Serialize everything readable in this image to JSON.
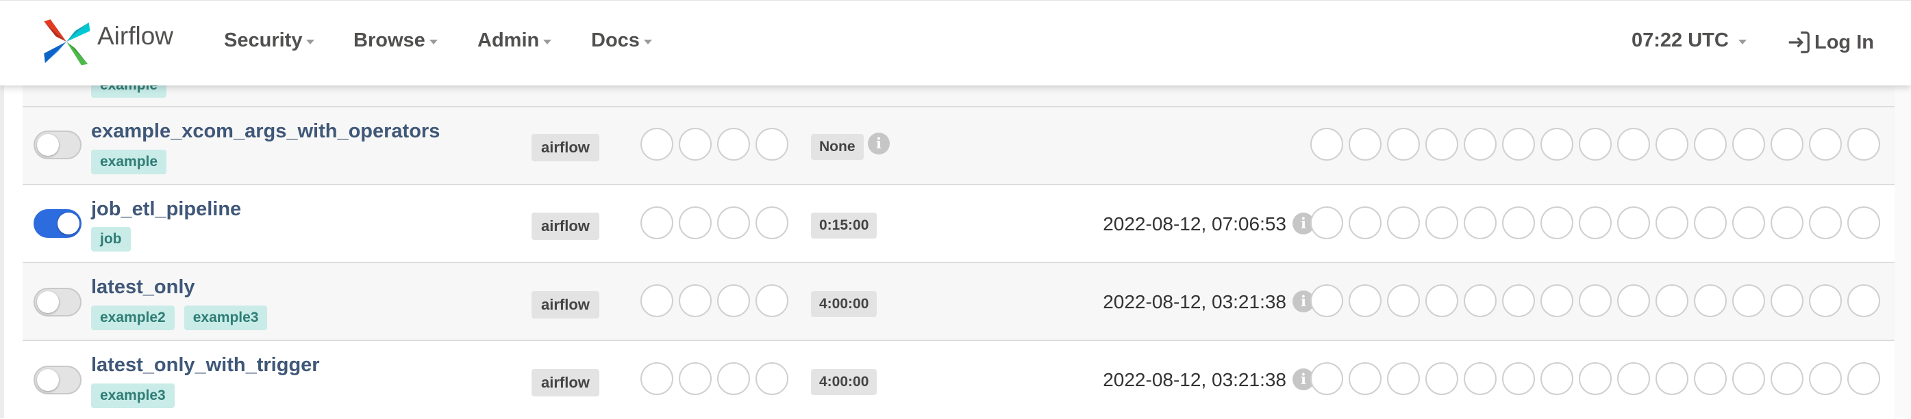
{
  "navbar": {
    "brand": "Airflow",
    "items": [
      {
        "label": "Security"
      },
      {
        "label": "Browse"
      },
      {
        "label": "Admin"
      },
      {
        "label": "Docs"
      }
    ],
    "time": "07:22 UTC",
    "login": "Log In"
  },
  "partial_row": {
    "tag": "example"
  },
  "rows": [
    {
      "name": "example_xcom_args_with_operators",
      "tags": [
        "example"
      ],
      "owner": "airflow",
      "schedule": "None",
      "next_run": "",
      "paused": true
    },
    {
      "name": "job_etl_pipeline",
      "tags": [
        "job"
      ],
      "owner": "airflow",
      "schedule": "0:15:00",
      "next_run": "2022-08-12, 07:06:53",
      "paused": false
    },
    {
      "name": "latest_only",
      "tags": [
        "example2",
        "example3"
      ],
      "owner": "airflow",
      "schedule": "4:00:00",
      "next_run": "2022-08-12, 03:21:38",
      "paused": true
    },
    {
      "name": "latest_only_with_trigger",
      "tags": [
        "example3"
      ],
      "owner": "airflow",
      "schedule": "4:00:00",
      "next_run": "2022-08-12, 03:21:38",
      "paused": true
    }
  ],
  "info_icon_glyph": "i",
  "colors": {
    "toggle_on": "#2d6cdf",
    "tag_bg": "#c9ece8",
    "dag_link": "#3f5778"
  }
}
